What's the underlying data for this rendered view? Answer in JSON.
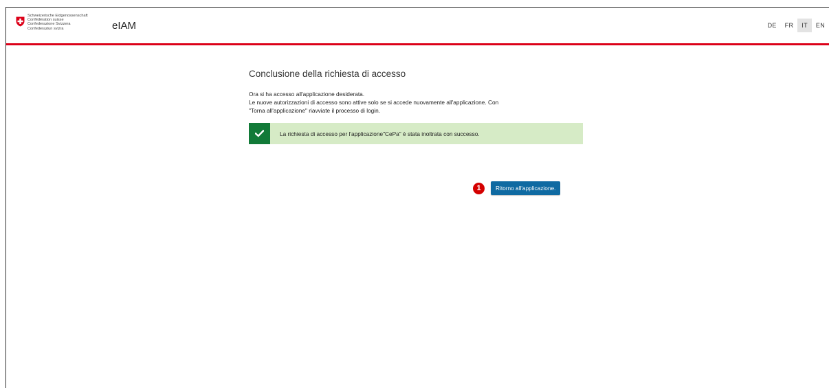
{
  "header": {
    "confederation_lines": [
      "Schweizerische Eidgenossenschaft",
      "Confédération suisse",
      "Confederazione Svizzera",
      "Confederaziun svizra"
    ],
    "app_title": "eIAM",
    "languages": [
      "DE",
      "FR",
      "IT",
      "EN"
    ],
    "active_language": "IT",
    "brand_color": "#dc0018"
  },
  "main": {
    "heading": "Conclusione della richiesta di accesso",
    "intro_lines": [
      "Ora si ha accesso all'applicazione desiderata.",
      "Le nuove autorizzazioni di accesso sono attive solo se si accede nuovamente all'applicazione. Con",
      "\"Torna all'applicazione\" riavviate il processo di login."
    ],
    "alert": {
      "icon": "checkmark-icon",
      "text": "La richiesta di accesso per l'applicazione\"CePa\" è stata inoltrata con successo.",
      "background": "#d6ebc6",
      "icon_background": "#127a38"
    },
    "step_marker": "1",
    "return_button_label": "Ritorno all'applicazione."
  }
}
